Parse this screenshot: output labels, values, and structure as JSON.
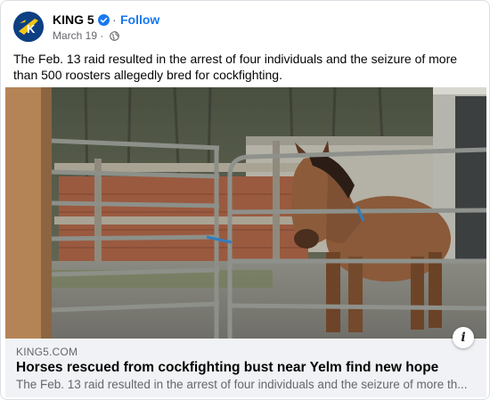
{
  "post": {
    "page_name": "KING 5",
    "separator": "·",
    "follow_label": "Follow",
    "date": "March 19",
    "date_separator": "·",
    "privacy_icon": "globe-icon",
    "verified_icon": "verified-badge-icon",
    "avatar_text": "K",
    "text": "The Feb. 13 raid resulted in the arrest of four individuals and the seizure of more than 500 roosters allegedly bred for cockfighting."
  },
  "link_preview": {
    "domain": "KING5.COM",
    "title": "Horses rescued from cockfighting bust near Yelm find new hope",
    "description": "The Feb. 13 raid resulted in the arrest of four individuals and the seizure of more th...",
    "info_label": "i",
    "info_icon": "info-icon"
  },
  "colors": {
    "accent": "#1877f2",
    "secondary_text": "#65676b",
    "footer_bg": "#f0f2f5",
    "avatar_bg": "#0d3f82",
    "avatar_logo": "#f3c614"
  }
}
